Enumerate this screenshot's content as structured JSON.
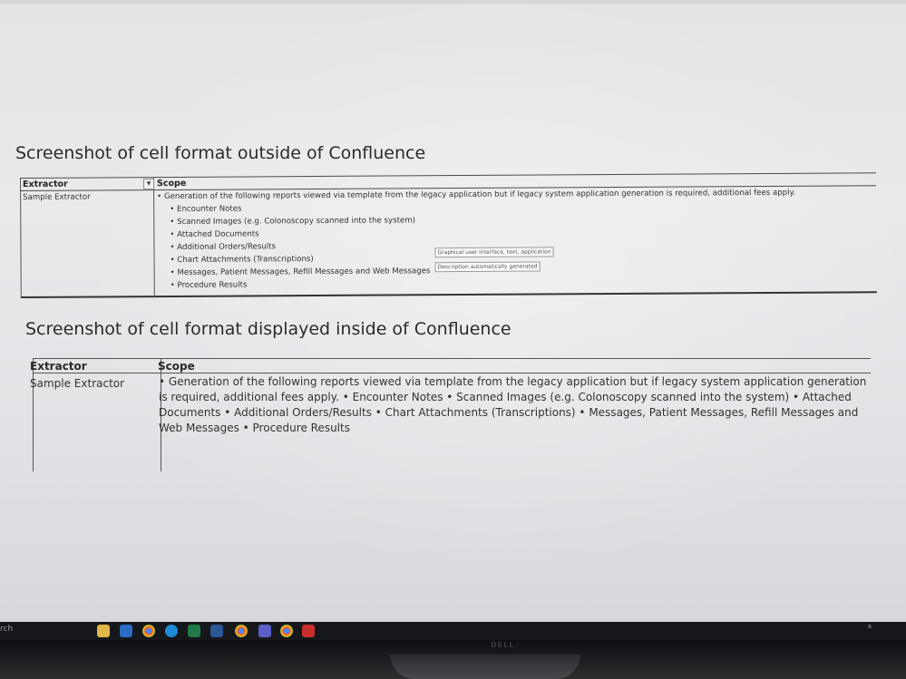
{
  "heading_outside": "Screenshot of cell format outside of Confluence",
  "heading_inside": "Screenshot of cell format displayed inside of Confluence",
  "table_excel": {
    "col1_header": "Extractor",
    "col2_header": "Scope",
    "extractor_value": "Sample Extractor",
    "scope_first_line": "• Generation of the following reports viewed via template from the legacy application but if legacy system application generation is required, additional fees apply.",
    "bullets": [
      "• Encounter Notes",
      "• Scanned Images (e.g. Colonoscopy scanned into the system)",
      "• Attached Documents",
      "• Additional Orders/Results",
      "• Chart Attachments (Transcriptions)",
      "• Messages, Patient Messages, Refill Messages and Web Messages",
      "• Procedure Results"
    ],
    "tooltip_line1": "Graphical user interface, text, application",
    "tooltip_line2": "Description automatically generated"
  },
  "table_confluence": {
    "col1_header": "Extractor",
    "col2_header": "Scope",
    "extractor_value": "Sample Extractor",
    "scope_text": "• Generation of the following reports viewed via template from the legacy application but if legacy system application generation is required, additional fees apply. • Encounter Notes • Scanned Images (e.g. Colonoscopy scanned into the system) • Attached Documents • Additional Orders/Results • Chart Attachments (Transcriptions) • Messages, Patient Messages, Refill Messages and Web Messages • Procedure Results"
  },
  "taskbar": {
    "search_fragment": "rch",
    "icons": [
      "file-explorer-icon",
      "outlook-icon",
      "chrome-icon",
      "edge-icon",
      "excel-icon",
      "word-icon",
      "chrome-icon",
      "teams-icon",
      "chrome-icon",
      "acrobat-icon"
    ],
    "tray_text": "ᴿ"
  },
  "monitor_brand": "DELL"
}
